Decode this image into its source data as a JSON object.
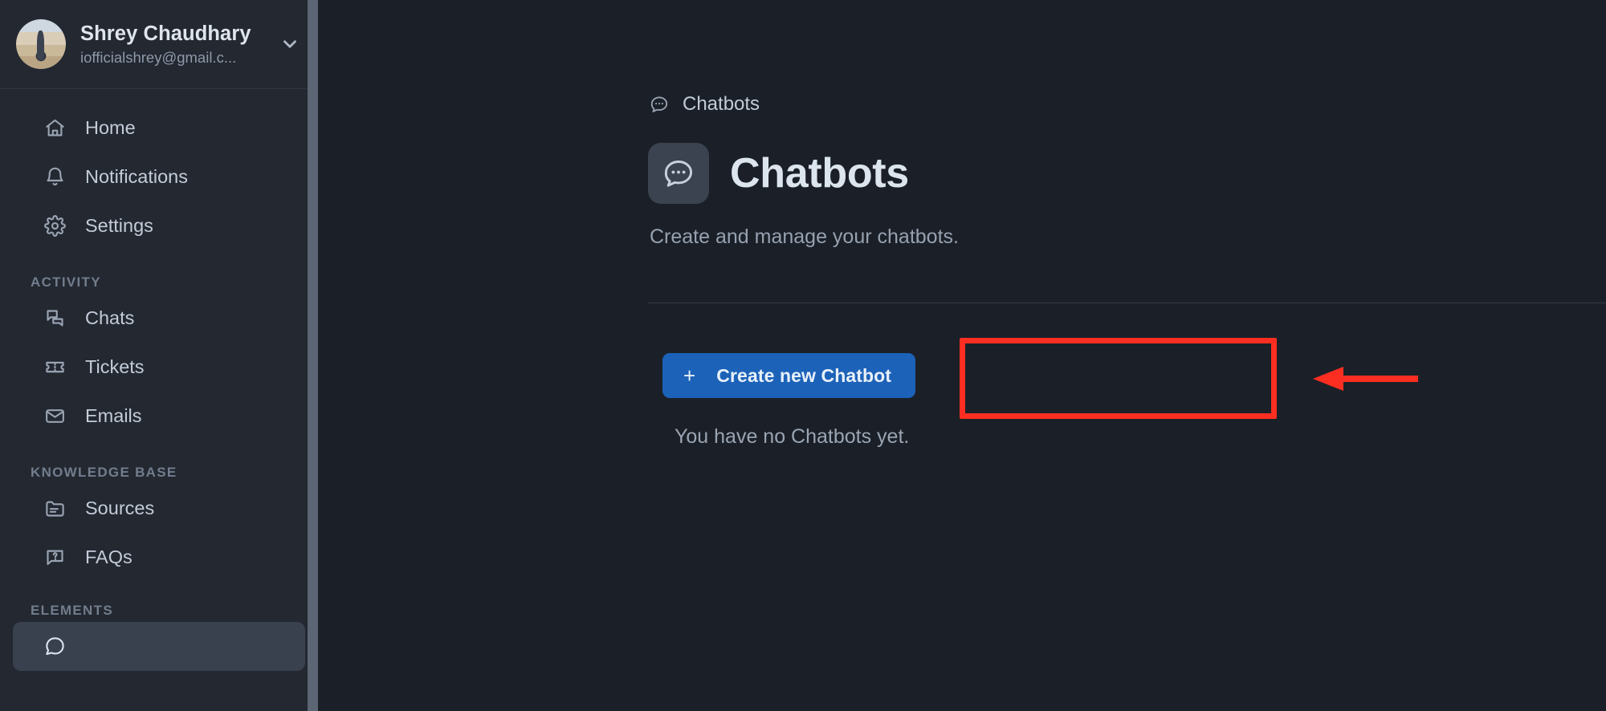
{
  "account": {
    "name": "Shrey Chaudhary",
    "email": "iofficialshrey@gmail.c...",
    "avatar_icon": "user-avatar-photo",
    "chevron_icon": "chevron-down-icon"
  },
  "sidebar": {
    "primary_items": [
      {
        "label": "Home",
        "icon": "home-icon"
      },
      {
        "label": "Notifications",
        "icon": "bell-icon"
      },
      {
        "label": "Settings",
        "icon": "gear-icon"
      }
    ],
    "sections": [
      {
        "title": "ACTIVITY",
        "items": [
          {
            "label": "Chats",
            "icon": "chat-bubbles-icon"
          },
          {
            "label": "Tickets",
            "icon": "ticket-icon"
          },
          {
            "label": "Emails",
            "icon": "envelope-icon"
          }
        ]
      },
      {
        "title": "KNOWLEDGE BASE",
        "items": [
          {
            "label": "Sources",
            "icon": "folder-icon"
          },
          {
            "label": "FAQs",
            "icon": "question-bubble-icon"
          }
        ]
      },
      {
        "title": "ELEMENTS",
        "items": [
          {
            "label": "",
            "icon": "chatbot-icon",
            "active": true
          }
        ]
      }
    ]
  },
  "main": {
    "breadcrumb": {
      "label": "Chatbots",
      "icon": "chat-dots-icon"
    },
    "page_title": "Chatbots",
    "page_badge_icon": "chat-dots-icon",
    "subtitle": "Create and manage your chatbots.",
    "create_button": {
      "label": "Create new Chatbot",
      "plus": "+"
    },
    "empty_state": "You have no Chatbots yet."
  },
  "annotations": {
    "highlight_color": "#fc2e21",
    "arrow_icon": "left-arrow-annotation",
    "box_icon": "highlight-box-annotation"
  },
  "colors": {
    "sidebar_bg": "#232831",
    "main_bg": "#1b2028",
    "accent_blue": "#1c62b9",
    "annotation_red": "#fc2e21"
  }
}
